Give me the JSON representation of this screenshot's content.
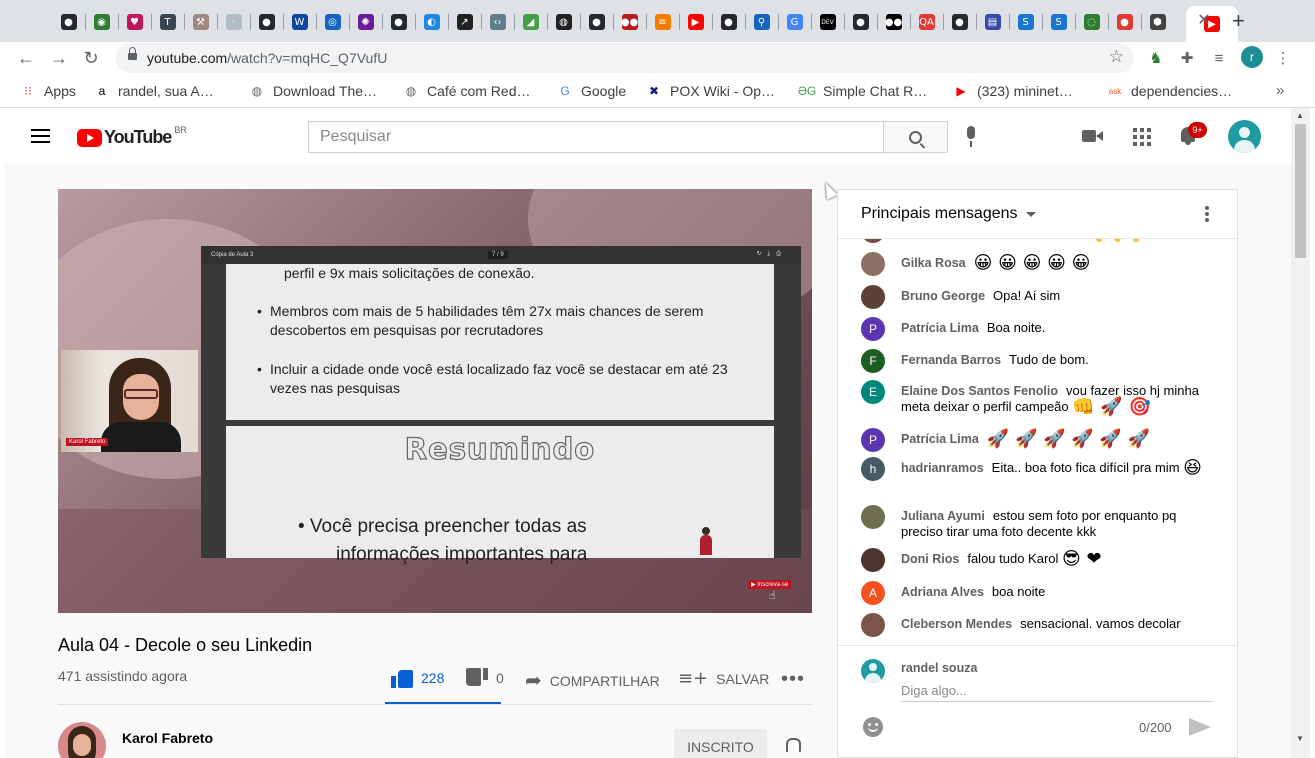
{
  "browser": {
    "tabs": [
      {
        "icon": "github-icon",
        "color": "#24292e",
        "glyph": "●"
      },
      {
        "icon": "green-circle-icon",
        "color": "#2e7d32",
        "glyph": "◉"
      },
      {
        "icon": "heart-icon",
        "color": "#c2185b",
        "glyph": "♥"
      },
      {
        "icon": "t-icon",
        "color": "#37474f",
        "glyph": "T"
      },
      {
        "icon": "hammer-icon",
        "color": "#a1887f",
        "glyph": "⚒"
      },
      {
        "icon": "blank-icon",
        "color": "#b0bec5",
        "glyph": "·"
      },
      {
        "icon": "github-icon",
        "color": "#24292e",
        "glyph": "●"
      },
      {
        "icon": "w-icon",
        "color": "#0d47a1",
        "glyph": "W"
      },
      {
        "icon": "swirl-icon",
        "color": "#1565c0",
        "glyph": "◎"
      },
      {
        "icon": "gear-icon",
        "color": "#6a1b9a",
        "glyph": "✺"
      },
      {
        "icon": "github-icon",
        "color": "#24292e",
        "glyph": "●"
      },
      {
        "icon": "messenger-icon",
        "color": "#1e88e5",
        "glyph": "◐"
      },
      {
        "icon": "dark-arrow-icon",
        "color": "#212121",
        "glyph": "↗"
      },
      {
        "icon": "code-icon",
        "color": "#607d8b",
        "glyph": "‹›"
      },
      {
        "icon": "leaf-icon",
        "color": "#43a047",
        "glyph": "◢"
      },
      {
        "icon": "globe-icon",
        "color": "#212121",
        "glyph": "◍"
      },
      {
        "icon": "github-icon",
        "color": "#24292e",
        "glyph": "●"
      },
      {
        "icon": "dots-icon",
        "color": "#b71c1c",
        "glyph": "●●"
      },
      {
        "icon": "stack-icon",
        "color": "#f57c00",
        "glyph": "≡"
      },
      {
        "icon": "youtube-icon",
        "color": "#ff0000",
        "glyph": "▶"
      },
      {
        "icon": "github-icon",
        "color": "#24292e",
        "glyph": "●"
      },
      {
        "icon": "search-icon",
        "color": "#1565c0",
        "glyph": "⚲"
      },
      {
        "icon": "google-icon",
        "color": "#4285f4",
        "glyph": "G"
      },
      {
        "icon": "dev-icon",
        "color": "#000000",
        "glyph": "DEV"
      },
      {
        "icon": "github-icon",
        "color": "#24292e",
        "glyph": "●"
      },
      {
        "icon": "medium-icon",
        "color": "#000000",
        "glyph": "●●"
      },
      {
        "icon": "qa-icon",
        "color": "#e53935",
        "glyph": "QA"
      },
      {
        "icon": "github-icon",
        "color": "#24292e",
        "glyph": "●"
      },
      {
        "icon": "form-icon",
        "color": "#3949ab",
        "glyph": "▤"
      },
      {
        "icon": "s-icon",
        "color": "#1976d2",
        "glyph": "S"
      },
      {
        "icon": "s-icon",
        "color": "#1976d2",
        "glyph": "S"
      },
      {
        "icon": "ring-icon",
        "color": "#2e7d32",
        "glyph": "◌"
      },
      {
        "icon": "tomato-icon",
        "color": "#e53935",
        "glyph": "●"
      },
      {
        "icon": "hex-icon",
        "color": "#424242",
        "glyph": "⬢"
      }
    ],
    "active_tab_icon": "youtube-icon",
    "url_host": "youtube.com",
    "url_path": "/watch?v=mqHC_Q7VufU",
    "profile_letter": "r",
    "bookmarks": [
      {
        "label": "Apps",
        "icon": "apps-grid-icon",
        "glyph": "⁝⁝",
        "color": "#ea4335"
      },
      {
        "label": "randel, sua A…",
        "icon": "amazon-icon",
        "glyph": "a",
        "color": "#000000"
      },
      {
        "label": "Download The…",
        "icon": "globe-icon",
        "glyph": "◍",
        "color": "#5f6368"
      },
      {
        "label": "Café com Red…",
        "icon": "globe-icon",
        "glyph": "◍",
        "color": "#5f6368"
      },
      {
        "label": "Google",
        "icon": "google-icon",
        "glyph": "G",
        "color": "#4285f4"
      },
      {
        "label": "POX Wiki - Op…",
        "icon": "x-icon",
        "glyph": "✖",
        "color": "#1a237e"
      },
      {
        "label": "Simple Chat R…",
        "icon": "chat-icon",
        "glyph": "ƏG",
        "color": "#43a047"
      },
      {
        "label": "(323) mininet…",
        "icon": "youtube-icon",
        "glyph": "▶",
        "color": "#ff0000"
      },
      {
        "label": "dependencies…",
        "icon": "ask-icon",
        "glyph": "ask",
        "color": "#f4511e"
      }
    ]
  },
  "youtube": {
    "logo_text": "YouTube",
    "country": "BR",
    "search_placeholder": "Pesquisar",
    "notification_badge": "9+"
  },
  "video": {
    "slide_doc_title": "Cópia de Aula 3",
    "slide_page": "7 / 9",
    "slide_fragment": "perfil e 9x mais solicitações de conexão.",
    "slide_bullets": [
      "Membros com mais de 5 habilidades têm 27x mais chances de serem descobertos em pesquisas por recrutadores",
      "Incluir a cidade onde você está localizado faz você se destacar em até 23 vezes nas pesquisas"
    ],
    "slide2_heading": "Resumindo",
    "slide2_bullet_line1": "• Você precisa preencher todas as",
    "slide2_bullet_line2": "informações   importantes    para",
    "cam_name": "Karol Fabreto",
    "subscribe_badge": "Inscreva-se",
    "title": "Aula 04 - Decole o seu Linkedin",
    "viewers": "471 assistindo agora",
    "likes": "228",
    "dislikes": "0",
    "share_label": "COMPARTILHAR",
    "save_label": "SALVAR",
    "channel_name": "Karol Fabreto",
    "subscribed_label": "INSCRITO"
  },
  "chat": {
    "title": "Principais mensagens",
    "messages": [
      {
        "author": "Gilka Rosa",
        "text": "",
        "emojis": "😀 😀 😀 😀 😀",
        "avatar_color": "#8d6e63",
        "initial": ""
      },
      {
        "author": "Bruno George",
        "text": "Opa! Aí sim",
        "emojis": "",
        "avatar_color": "#5d4037",
        "initial": ""
      },
      {
        "author": "Patrícia Lima",
        "text": "Boa noite.",
        "emojis": "",
        "avatar_color": "#5e35b1",
        "initial": "P"
      },
      {
        "author": "Fernanda Barros",
        "text": "Tudo de bom.",
        "emojis": "",
        "avatar_color": "#1b5e20",
        "initial": "F"
      },
      {
        "author": "Elaine Dos Santos Fenolio",
        "text": "vou fazer isso hj minha meta deixar o perfil campeão",
        "emojis": "👊 🚀 🎯",
        "avatar_color": "#00897b",
        "initial": "E"
      },
      {
        "author": "Patrícia Lima",
        "text": "",
        "emojis": "🚀 🚀 🚀 🚀 🚀 🚀",
        "avatar_color": "#5e35b1",
        "initial": "P"
      },
      {
        "author": "hadrianramos",
        "text": "Eita.. boa foto fica difícil pra mim",
        "emojis": "😆",
        "avatar_color": "#455a64",
        "initial": "h"
      },
      {
        "author": "Juliana Ayumi",
        "text": "estou sem foto por enquanto pq preciso tirar uma foto decente kkk",
        "emojis": "",
        "avatar_color": "#6d6d4f",
        "initial": ""
      },
      {
        "author": "Doni Rios",
        "text": "falou tudo Karol",
        "emojis": "😎 ❤",
        "avatar_color": "#4e342e",
        "initial": ""
      },
      {
        "author": "Adriana Alves",
        "text": "boa noite",
        "emojis": "",
        "avatar_color": "#f4511e",
        "initial": "A"
      },
      {
        "author": "Cleberson Mendes",
        "text": "sensacional. vamos decolar",
        "emojis": "",
        "avatar_color": "#795548",
        "initial": ""
      }
    ],
    "me_name": "randel souza",
    "input_placeholder": "Diga algo...",
    "char_count": "0/200"
  }
}
